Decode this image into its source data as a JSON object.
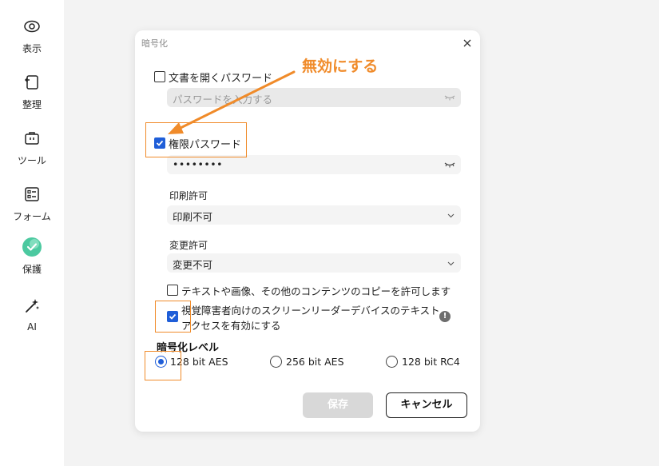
{
  "sidebar": {
    "items": [
      {
        "label": "表示",
        "icon": "eye-icon"
      },
      {
        "label": "整理",
        "icon": "organize-icon"
      },
      {
        "label": "ツール",
        "icon": "toolbox-icon"
      },
      {
        "label": "フォーム",
        "icon": "form-icon"
      },
      {
        "label": "保護",
        "icon": "shield-icon"
      },
      {
        "label": "AI",
        "icon": "magic-wand-icon"
      }
    ]
  },
  "dialog": {
    "title": "暗号化",
    "open_password": {
      "label": "文書を開くパスワード",
      "checked": false,
      "placeholder": "パスワードを入力する"
    },
    "permission_password": {
      "label": "権限パスワード",
      "checked": true,
      "value": "••••••••"
    },
    "print_permission": {
      "label": "印刷許可",
      "value": "印刷不可"
    },
    "change_permission": {
      "label": "変更許可",
      "value": "変更不可"
    },
    "copy_option": {
      "label": "テキストや画像、その他のコンテンツのコピーを許可します",
      "checked": false
    },
    "screen_reader_option": {
      "line1": "視覚障害者向けのスクリーンリーダーデバイスのテキスト",
      "line2": "アクセスを有効にする",
      "checked": true
    },
    "encryption_level": {
      "title": "暗号化レベル",
      "options": [
        {
          "label": "128 bit AES",
          "selected": true
        },
        {
          "label": "256 bit AES",
          "selected": false
        },
        {
          "label": "128 bit RC4",
          "selected": false
        }
      ]
    },
    "save_label": "保存",
    "cancel_label": "キャンセル"
  },
  "annotation": {
    "text": "無効にする",
    "color": "#f08b2a"
  },
  "colors": {
    "accent": "#1f5ed8",
    "annotation": "#f08b2a"
  }
}
